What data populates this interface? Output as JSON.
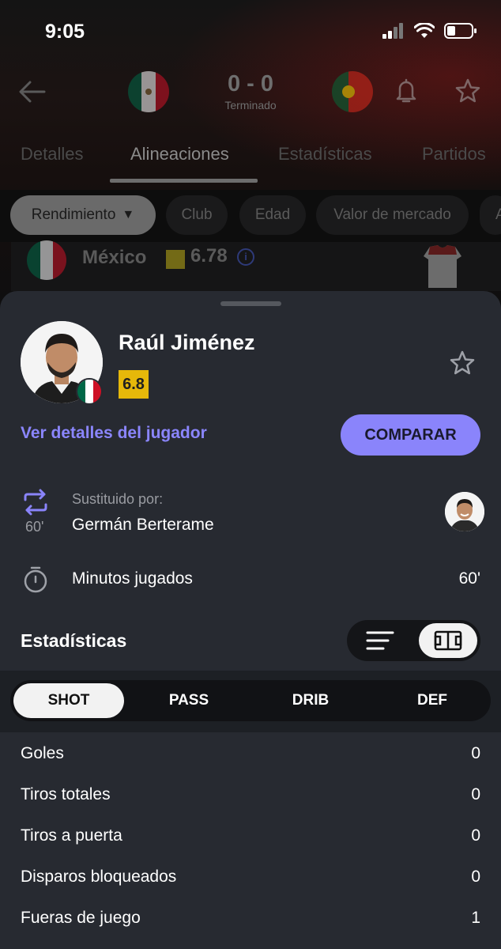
{
  "status_bar": {
    "time": "9:05"
  },
  "match": {
    "score": "0 - 0",
    "status": "Terminado",
    "home_flag": "mexico-flag",
    "away_flag": "portugal-flag"
  },
  "tabs": [
    {
      "label": "Detalles"
    },
    {
      "label": "Alineaciones"
    },
    {
      "label": "Estadísticas"
    },
    {
      "label": "Partidos"
    }
  ],
  "filter_chips": [
    {
      "label": "Rendimiento"
    },
    {
      "label": "Club"
    },
    {
      "label": "Edad"
    },
    {
      "label": "Valor de mercado"
    },
    {
      "label": "A"
    }
  ],
  "team_row": {
    "name": "México",
    "rating": "6.78"
  },
  "player": {
    "name": "Raúl Jiménez",
    "rating": "6.8",
    "details_link": "Ver detalles del jugador",
    "compare_label": "COMPARAR"
  },
  "substitution": {
    "label": "Sustituido por:",
    "player": "Germán Berterame",
    "minute": "60'"
  },
  "minutes": {
    "label": "Minutos jugados",
    "value": "60'"
  },
  "stats": {
    "title": "Estadísticas",
    "tabs": [
      {
        "label": "SHOT"
      },
      {
        "label": "PASS"
      },
      {
        "label": "DRIB"
      },
      {
        "label": "DEF"
      }
    ],
    "rows": [
      {
        "label": "Goles",
        "value": "0"
      },
      {
        "label": "Tiros totales",
        "value": "0"
      },
      {
        "label": "Tiros a puerta",
        "value": "0"
      },
      {
        "label": "Disparos bloqueados",
        "value": "0"
      },
      {
        "label": "Fueras de juego",
        "value": "1"
      }
    ]
  },
  "colors": {
    "accent": "#8a84fb",
    "rating_yellow": "#e6b80a",
    "sheet_bg": "#272a31"
  }
}
